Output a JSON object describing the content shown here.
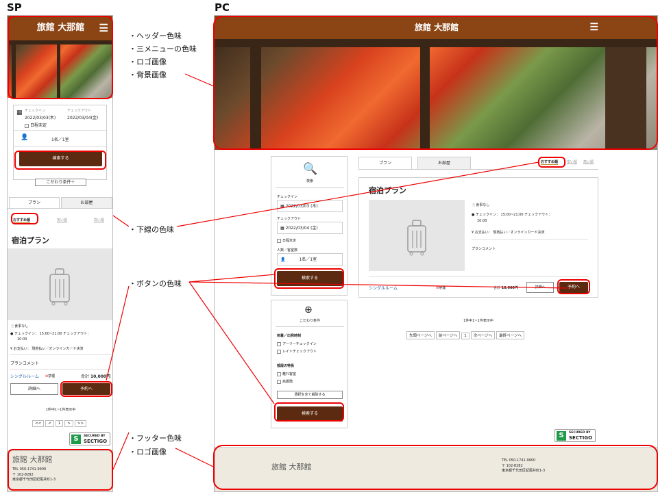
{
  "labels": {
    "sp": "SP",
    "pc": "PC"
  },
  "notes": {
    "header_color": "・ヘッダー色味",
    "menu_color": "・三メニューの色味",
    "logo": "・ロゴ画像",
    "bg": "・背景画像",
    "underline": "・下線の色味",
    "button": "・ボタンの色味",
    "footer_color": "・フッター色味",
    "footer_logo": "・ロゴ画像"
  },
  "brand": {
    "name": "旅館 大那館",
    "header_color": "#8b4514",
    "button_color": "#5c2a10",
    "highlight": "#e00000",
    "footer_bg": "#eeeae0"
  },
  "search": {
    "title": "検索",
    "checkin_label": "チェックイン",
    "checkout_label": "チェックアウト",
    "checkin_sp": "2022/03/03(木)",
    "checkout_sp": "2022/03/04(金)",
    "checkin_pc": "2022/03/03 (木)",
    "checkout_pc": "2022/03/04 (金)",
    "undecided": "日程未定",
    "guests_label": "人数／客室数",
    "guests": "1名／1室",
    "submit": "検索する",
    "kodawari_btn": "こだわり条件＋",
    "kodawari_title": "こだわり条件",
    "arrival_title": "到着／出発時刻",
    "early_checkin": "アーリーチェックイン",
    "late_checkout": "レイトチェックアウト",
    "room_feature_title": "部屋の特長",
    "room_feature_1": "離れ客室",
    "room_feature_2": "高層階",
    "clear_all": "選択を全て解除する"
  },
  "tabs": {
    "plan": "プラン",
    "room": "お部屋"
  },
  "sort": {
    "recommended": "おすすめ順",
    "cheap": "安い順",
    "expensive": "高い順"
  },
  "plan": {
    "title": "宿泊プラン",
    "meal": "食事なし",
    "checkin_time": "チェックイン： 15:00~21:00 チェックアウト：",
    "checkout_time": "10:00",
    "payment": "お支払い： 現地払い／オンラインカード決済",
    "comment": "プランコメント",
    "room": "シングルルーム",
    "smoking": "禁煙",
    "total_label": "合計",
    "total": "10,000円",
    "details": "詳細へ",
    "reserve": "予約へ"
  },
  "pager": {
    "summary": "1件中1~1件表示中",
    "first_sp": "<<",
    "prev_sp": "<",
    "page": "1",
    "next_sp": ">",
    "last_sp": ">>",
    "first": "先頭ページへ",
    "prev": "前ページへ",
    "next": "次ページへ",
    "last": "最終ページへ"
  },
  "secured": {
    "line1": "SECURED BY",
    "line2": "SECTIGO"
  },
  "footer": {
    "name": "旅館 大那館",
    "tel": "TEL 050-1741-9900",
    "zip": "〒 102-8282",
    "address": "東京都千代田区紀尾井町1-3"
  }
}
